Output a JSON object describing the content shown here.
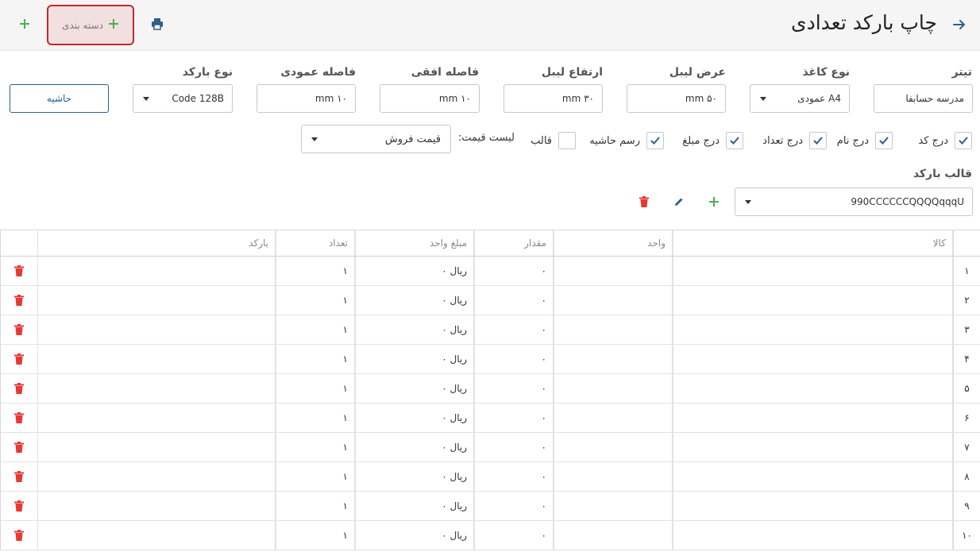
{
  "header": {
    "title": "چاپ بارکد تعدادی",
    "category_button": "دسته بندی"
  },
  "fields": {
    "title": {
      "label": "تیتر",
      "value": "مدرسه حسابفا"
    },
    "paper_type": {
      "label": "نوع کاغذ",
      "value": "A4 عمودی"
    },
    "label_width": {
      "label": "عرض لیبل",
      "value": "۵۰ mm"
    },
    "label_height": {
      "label": "ارتفاع لیبل",
      "value": "۳۰ mm"
    },
    "h_spacing": {
      "label": "فاصله افقی",
      "value": "۱۰ mm"
    },
    "v_spacing": {
      "label": "فاصله عمودی",
      "value": "۱۰ mm"
    },
    "barcode_type": {
      "label": "نوع بارکد",
      "value": "Code 128B"
    },
    "margin_button": "حاشیه"
  },
  "checks": [
    {
      "label": "درج کد",
      "checked": true
    },
    {
      "label": "درج نام",
      "checked": true
    },
    {
      "label": "درج تعداد",
      "checked": true
    },
    {
      "label": "درج مبلغ",
      "checked": true
    },
    {
      "label": "رسم حاشیه",
      "checked": true
    },
    {
      "label": "قالب",
      "checked": false
    }
  ],
  "price_list": {
    "label": "لیست قیمت:",
    "value": "قیمت فروش"
  },
  "barcode_template": {
    "label": "قالب بارکد",
    "value": "990CCCCCCQQQQqqqU"
  },
  "table": {
    "headers": {
      "goods": "کالا",
      "unit": "واحد",
      "amount": "مقدار",
      "unit_price": "مبلغ واحد",
      "count": "تعداد",
      "barcode": "بارکد"
    },
    "rows": [
      {
        "idx": "۱",
        "goods": "",
        "unit": "",
        "amount": "۰",
        "unit_price": "ریال ۰",
        "count": "۱",
        "barcode": ""
      },
      {
        "idx": "۲",
        "goods": "",
        "unit": "",
        "amount": "۰",
        "unit_price": "ریال ۰",
        "count": "۱",
        "barcode": ""
      },
      {
        "idx": "۳",
        "goods": "",
        "unit": "",
        "amount": "۰",
        "unit_price": "ریال ۰",
        "count": "۱",
        "barcode": ""
      },
      {
        "idx": "۴",
        "goods": "",
        "unit": "",
        "amount": "۰",
        "unit_price": "ریال ۰",
        "count": "۱",
        "barcode": ""
      },
      {
        "idx": "۵",
        "goods": "",
        "unit": "",
        "amount": "۰",
        "unit_price": "ریال ۰",
        "count": "۱",
        "barcode": ""
      },
      {
        "idx": "۶",
        "goods": "",
        "unit": "",
        "amount": "۰",
        "unit_price": "ریال ۰",
        "count": "۱",
        "barcode": ""
      },
      {
        "idx": "۷",
        "goods": "",
        "unit": "",
        "amount": "۰",
        "unit_price": "ریال ۰",
        "count": "۱",
        "barcode": ""
      },
      {
        "idx": "۸",
        "goods": "",
        "unit": "",
        "amount": "۰",
        "unit_price": "ریال ۰",
        "count": "۱",
        "barcode": ""
      },
      {
        "idx": "۹",
        "goods": "",
        "unit": "",
        "amount": "۰",
        "unit_price": "ریال ۰",
        "count": "۱",
        "barcode": ""
      },
      {
        "idx": "۱۰",
        "goods": "",
        "unit": "",
        "amount": "۰",
        "unit_price": "ریال ۰",
        "count": "۱",
        "barcode": ""
      }
    ]
  },
  "colors": {
    "accent": "#2f5f8a",
    "add_green": "#4caf50",
    "delete_red": "#e53935",
    "category_border": "#c2282e"
  },
  "icons": {
    "back": "arrow-right-icon",
    "print": "printer-icon",
    "add": "plus-icon",
    "edit": "pencil-icon",
    "delete": "trash-icon"
  }
}
